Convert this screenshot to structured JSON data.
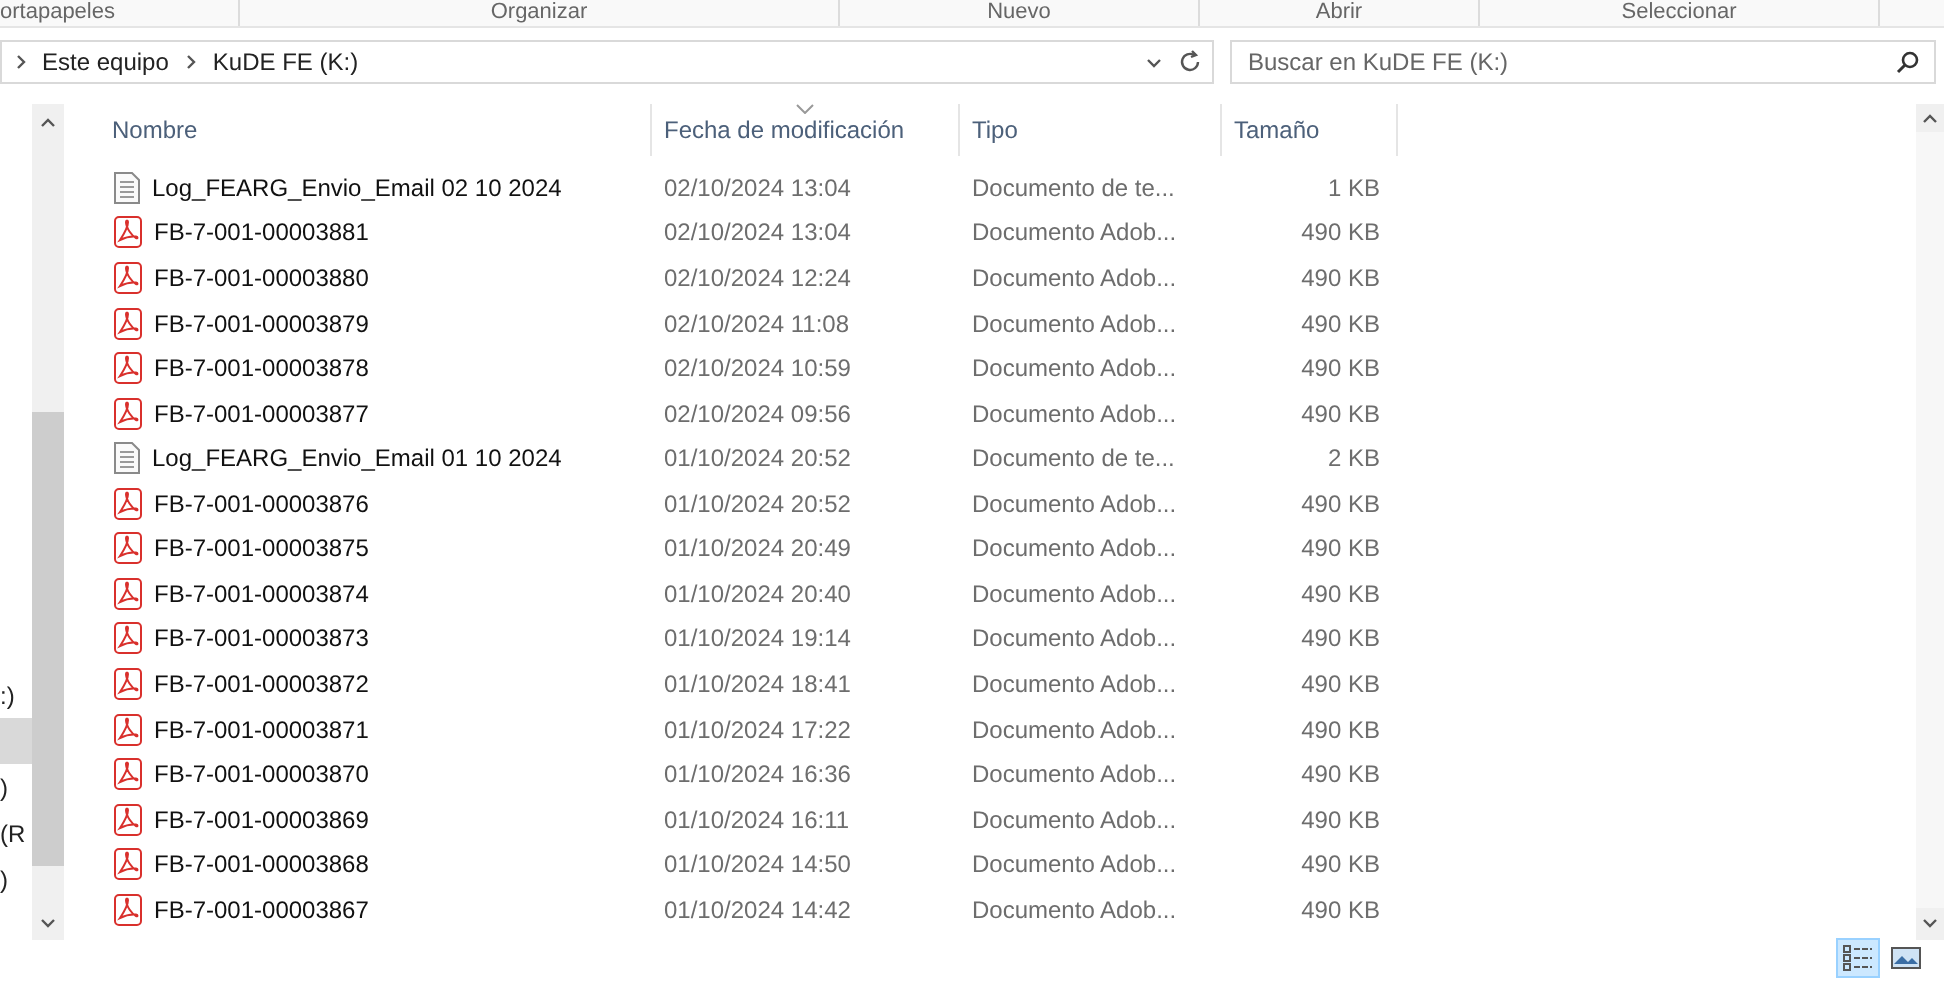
{
  "ribbon_groups": [
    "ortapapeles",
    "Organizar",
    "Nuevo",
    "Abrir",
    "Seleccionar"
  ],
  "address_bar": {
    "path": [
      "Este equipo",
      "KuDE FE (K:)"
    ]
  },
  "search": {
    "placeholder": "Buscar en KuDE FE (K:)"
  },
  "navigation_pane": {
    "items": [
      {
        "label": ":)",
        "selected": false
      },
      {
        "selected": true
      },
      {
        "label": ")",
        "selected": false
      },
      {
        "label": "(R",
        "selected": false
      },
      {
        "label": ")",
        "selected": false
      }
    ]
  },
  "columns": [
    {
      "label": "Nombre",
      "sorted": false
    },
    {
      "label": "Fecha de modificación",
      "sorted": true
    },
    {
      "label": "Tipo",
      "sorted": false
    },
    {
      "label": "Tamaño",
      "sorted": false
    }
  ],
  "rows": [
    {
      "kind": "text",
      "name": "Log_FEARG_Envio_Email 02 10 2024",
      "date": "02/10/2024 13:04",
      "type": "Documento de te...",
      "size": "1 KB"
    },
    {
      "kind": "pdf",
      "name": "FB-7-001-00003881",
      "date": "02/10/2024 13:04",
      "type": "Documento Adob...",
      "size": "490 KB"
    },
    {
      "kind": "pdf",
      "name": "FB-7-001-00003880",
      "date": "02/10/2024 12:24",
      "type": "Documento Adob...",
      "size": "490 KB"
    },
    {
      "kind": "pdf",
      "name": "FB-7-001-00003879",
      "date": "02/10/2024 11:08",
      "type": "Documento Adob...",
      "size": "490 KB"
    },
    {
      "kind": "pdf",
      "name": "FB-7-001-00003878",
      "date": "02/10/2024 10:59",
      "type": "Documento Adob...",
      "size": "490 KB"
    },
    {
      "kind": "pdf",
      "name": "FB-7-001-00003877",
      "date": "02/10/2024 09:56",
      "type": "Documento Adob...",
      "size": "490 KB"
    },
    {
      "kind": "text",
      "name": "Log_FEARG_Envio_Email 01 10 2024",
      "date": "01/10/2024 20:52",
      "type": "Documento de te...",
      "size": "2 KB"
    },
    {
      "kind": "pdf",
      "name": "FB-7-001-00003876",
      "date": "01/10/2024 20:52",
      "type": "Documento Adob...",
      "size": "490 KB"
    },
    {
      "kind": "pdf",
      "name": "FB-7-001-00003875",
      "date": "01/10/2024 20:49",
      "type": "Documento Adob...",
      "size": "490 KB"
    },
    {
      "kind": "pdf",
      "name": "FB-7-001-00003874",
      "date": "01/10/2024 20:40",
      "type": "Documento Adob...",
      "size": "490 KB"
    },
    {
      "kind": "pdf",
      "name": "FB-7-001-00003873",
      "date": "01/10/2024 19:14",
      "type": "Documento Adob...",
      "size": "490 KB"
    },
    {
      "kind": "pdf",
      "name": "FB-7-001-00003872",
      "date": "01/10/2024 18:41",
      "type": "Documento Adob...",
      "size": "490 KB"
    },
    {
      "kind": "pdf",
      "name": "FB-7-001-00003871",
      "date": "01/10/2024 17:22",
      "type": "Documento Adob...",
      "size": "490 KB"
    },
    {
      "kind": "pdf",
      "name": "FB-7-001-00003870",
      "date": "01/10/2024 16:36",
      "type": "Documento Adob...",
      "size": "490 KB"
    },
    {
      "kind": "pdf",
      "name": "FB-7-001-00003869",
      "date": "01/10/2024 16:11",
      "type": "Documento Adob...",
      "size": "490 KB"
    },
    {
      "kind": "pdf",
      "name": "FB-7-001-00003868",
      "date": "01/10/2024 14:50",
      "type": "Documento Adob...",
      "size": "490 KB"
    },
    {
      "kind": "pdf",
      "name": "FB-7-001-00003867",
      "date": "01/10/2024 14:42",
      "type": "Documento Adob...",
      "size": "490 KB"
    }
  ],
  "view_buttons": [
    {
      "kind": "details",
      "selected": true
    },
    {
      "kind": "tiles",
      "selected": false
    }
  ]
}
